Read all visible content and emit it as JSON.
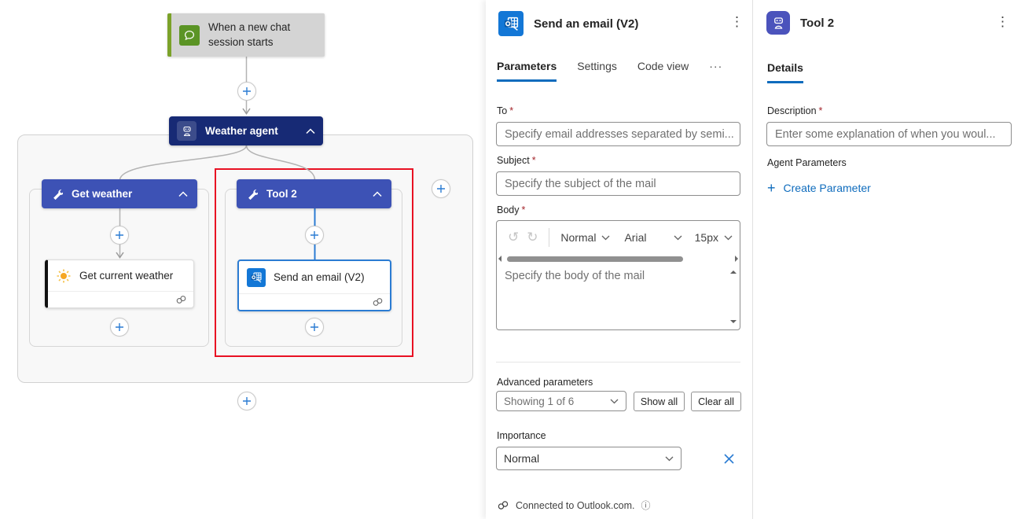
{
  "colors": {
    "accent_blue": "#0f6cbd",
    "selection_blue": "#2b7cd3",
    "branch_blue": "#3d52b5",
    "agent_navy": "#172a75",
    "selection_red": "#e81123",
    "trigger_green": "#7ba229"
  },
  "canvas": {
    "trigger": {
      "label": "When a new chat session starts"
    },
    "agent": {
      "label": "Weather agent"
    },
    "branches": [
      {
        "header": "Get weather",
        "action": {
          "label": "Get current weather"
        }
      },
      {
        "header": "Tool 2",
        "action": {
          "label": "Send an email (V2)"
        }
      }
    ]
  },
  "email_panel": {
    "title": "Send an email (V2)",
    "tabs": [
      {
        "label": "Parameters"
      },
      {
        "label": "Settings"
      },
      {
        "label": "Code view"
      }
    ],
    "fields": {
      "to": {
        "label": "To",
        "placeholder": "Specify email addresses separated by semi..."
      },
      "subject": {
        "label": "Subject",
        "placeholder": "Specify the subject of the mail"
      },
      "body": {
        "label": "Body",
        "placeholder": "Specify the body of the mail",
        "toolbar": {
          "style": "Normal",
          "font": "Arial",
          "size": "15px"
        }
      }
    },
    "advanced": {
      "label": "Advanced parameters",
      "dropdown_value": "Showing 1 of 6",
      "show_all": "Show all",
      "clear_all": "Clear all"
    },
    "importance": {
      "label": "Importance",
      "value": "Normal"
    },
    "footer": {
      "text": "Connected to Outlook.com."
    }
  },
  "tool_panel": {
    "title": "Tool 2",
    "tab": "Details",
    "description": {
      "label": "Description",
      "placeholder": "Enter some explanation of when you woul..."
    },
    "agent_parameters_label": "Agent Parameters",
    "create_parameter_label": "Create Parameter"
  }
}
